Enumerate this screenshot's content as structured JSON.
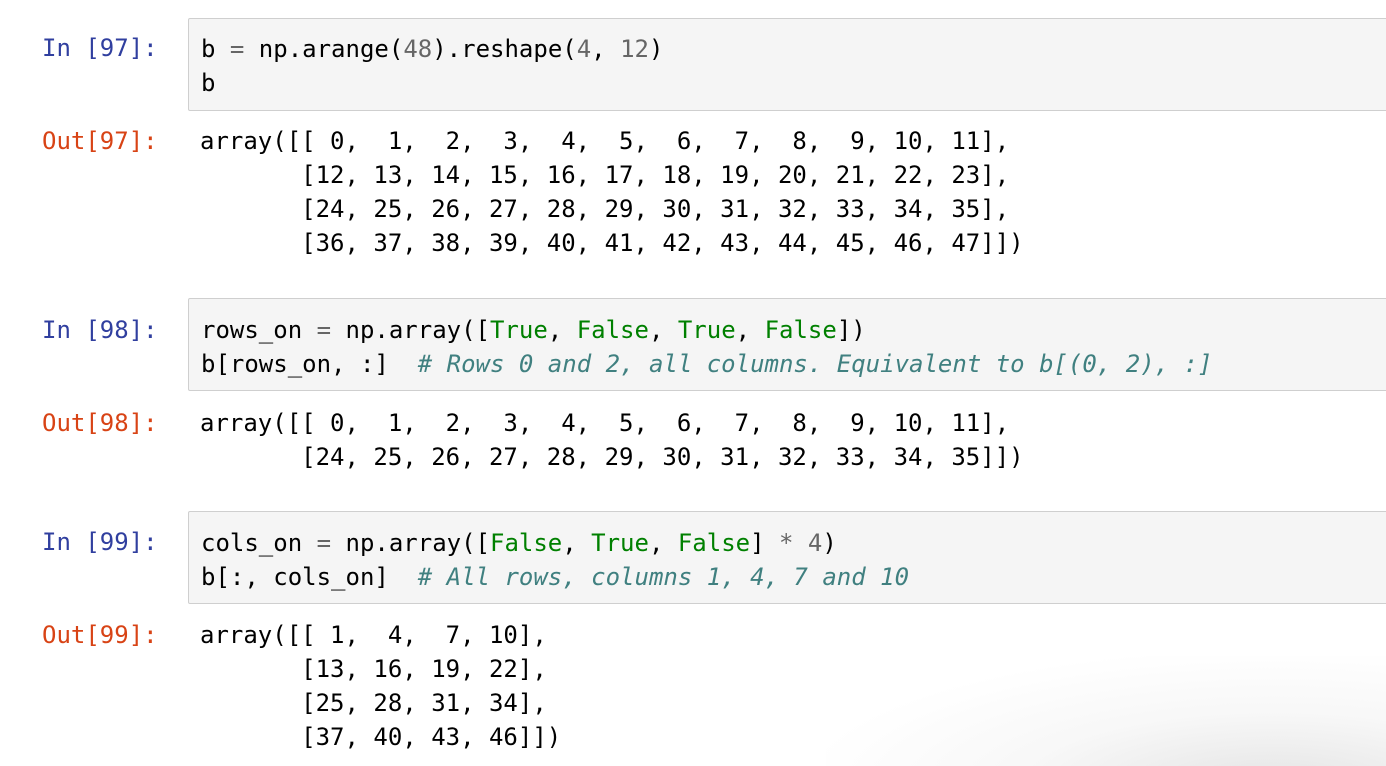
{
  "cells": [
    {
      "in_prompt": "In [97]:",
      "out_prompt": "Out[97]:",
      "input": {
        "line1": {
          "a": "b ",
          "b": "=",
          "c": " np.arange(",
          "d": "48",
          "e": ").reshape(",
          "f": "4",
          "g": ", ",
          "h": "12",
          "i": ")"
        },
        "line2": "b"
      },
      "output": [
        "array([[ 0,  1,  2,  3,  4,  5,  6,  7,  8,  9, 10, 11],",
        "       [12, 13, 14, 15, 16, 17, 18, 19, 20, 21, 22, 23],",
        "       [24, 25, 26, 27, 28, 29, 30, 31, 32, 33, 34, 35],",
        "       [36, 37, 38, 39, 40, 41, 42, 43, 44, 45, 46, 47]])"
      ]
    },
    {
      "in_prompt": "In [98]:",
      "out_prompt": "Out[98]:",
      "input": {
        "line1": {
          "a": "rows_on ",
          "b": "=",
          "c": " np.array([",
          "d": "True",
          "e": ", ",
          "f": "False",
          "g": ", ",
          "h": "True",
          "i": ", ",
          "j": "False",
          "k": "])"
        },
        "line2": {
          "a": "b[rows_on, :]  ",
          "b": "# Rows 0 and 2, all columns. Equivalent to b[(0, 2), :]"
        }
      },
      "output": [
        "array([[ 0,  1,  2,  3,  4,  5,  6,  7,  8,  9, 10, 11],",
        "       [24, 25, 26, 27, 28, 29, 30, 31, 32, 33, 34, 35]])"
      ]
    },
    {
      "in_prompt": "In [99]:",
      "out_prompt": "Out[99]:",
      "input": {
        "line1": {
          "a": "cols_on ",
          "b": "=",
          "c": " np.array([",
          "d": "False",
          "e": ", ",
          "f": "True",
          "g": ", ",
          "h": "False",
          "i": "] ",
          "j": "*",
          "k": " ",
          "l": "4",
          "m": ")"
        },
        "line2": {
          "a": "b[:, cols_on]  ",
          "b": "# All rows, columns 1, 4, 7 and 10"
        }
      },
      "output": [
        "array([[ 1,  4,  7, 10],",
        "       [13, 16, 19, 22],",
        "       [25, 28, 31, 34],",
        "       [37, 40, 43, 46]])"
      ]
    }
  ]
}
